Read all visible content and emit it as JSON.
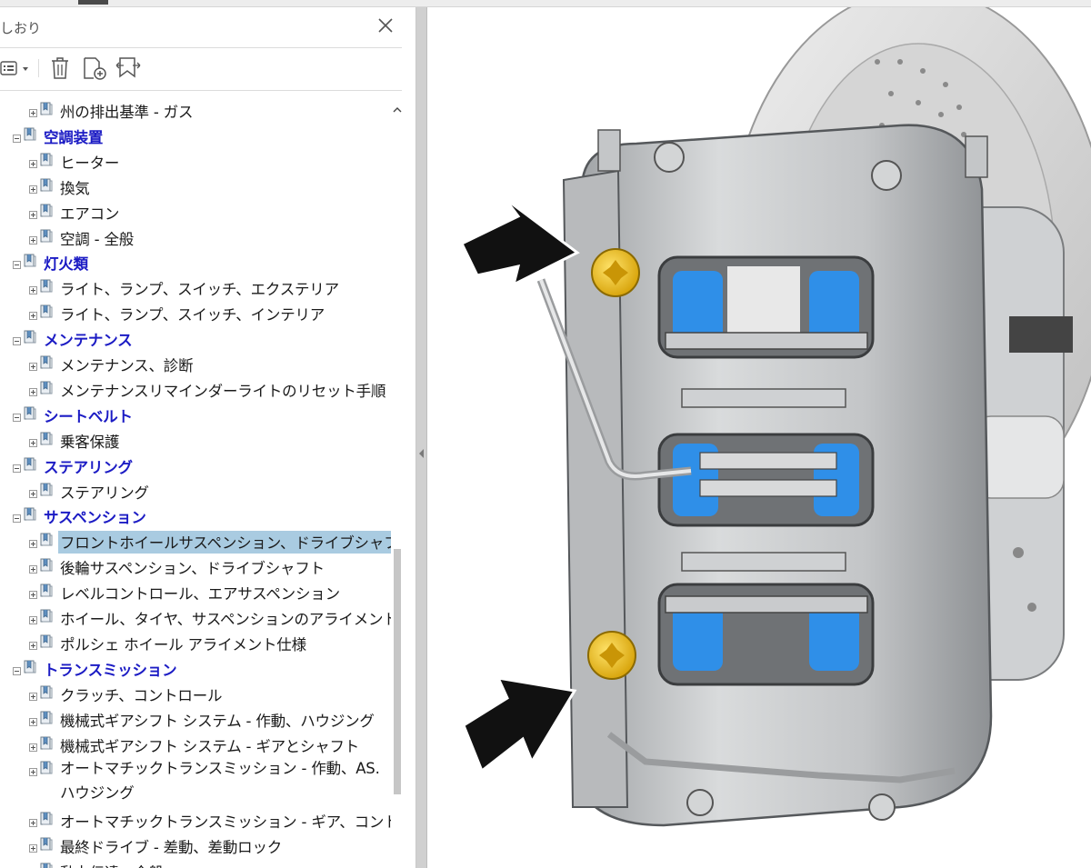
{
  "panel": {
    "title": "しおり",
    "toolbar": {
      "options_icon": "options-menu-icon",
      "delete_icon": "trash-icon",
      "new_bookmark_icon": "new-bookmark-icon",
      "expand_icon": "expand-bookmark-icon"
    }
  },
  "bookmarks": [
    {
      "level": 2,
      "label": "州の排出基準 - ガス",
      "expanded": false
    },
    {
      "level": 1,
      "label": "空調装置",
      "expanded": true
    },
    {
      "level": 2,
      "label": "ヒーター",
      "expanded": false
    },
    {
      "level": 2,
      "label": "換気",
      "expanded": false
    },
    {
      "level": 2,
      "label": "エアコン",
      "expanded": false
    },
    {
      "level": 2,
      "label": "空調 - 全般",
      "expanded": false
    },
    {
      "level": 1,
      "label": "灯火類",
      "expanded": true
    },
    {
      "level": 2,
      "label": "ライト、ランプ、スイッチ、エクステリア",
      "expanded": false
    },
    {
      "level": 2,
      "label": "ライト、ランプ、スイッチ、インテリア",
      "expanded": false
    },
    {
      "level": 1,
      "label": "メンテナンス",
      "expanded": true
    },
    {
      "level": 2,
      "label": "メンテナンス、診断",
      "expanded": false
    },
    {
      "level": 2,
      "label": "メンテナンスリマインダーライトのリセット手順",
      "expanded": false
    },
    {
      "level": 1,
      "label": "シートベルト",
      "expanded": true
    },
    {
      "level": 2,
      "label": "乗客保護",
      "expanded": false
    },
    {
      "level": 1,
      "label": "ステアリング",
      "expanded": true
    },
    {
      "level": 2,
      "label": "ステアリング",
      "expanded": false
    },
    {
      "level": 1,
      "label": "サスペンション",
      "expanded": true
    },
    {
      "level": 2,
      "label": "フロントホイールサスペンション、ドライブシャフト",
      "expanded": false,
      "selected": true
    },
    {
      "level": 2,
      "label": "後輪サスペンション、ドライブシャフト",
      "expanded": false
    },
    {
      "level": 2,
      "label": "レベルコントロール、エアサスペンション",
      "expanded": false
    },
    {
      "level": 2,
      "label": "ホイール、タイヤ、サスペンションのアライメント",
      "expanded": false
    },
    {
      "level": 2,
      "label": "ポルシェ ホイール アライメント仕様",
      "expanded": false
    },
    {
      "level": 1,
      "label": "トランスミッション",
      "expanded": true
    },
    {
      "level": 2,
      "label": "クラッチ、コントロール",
      "expanded": false
    },
    {
      "level": 2,
      "label": "機械式ギアシフト システム - 作動、ハウジング",
      "expanded": false
    },
    {
      "level": 2,
      "label": "機械式ギアシフト システム - ギアとシャフト",
      "expanded": false
    },
    {
      "level": 2,
      "label": "オートマチックトランスミッション - 作動、AS.ハウジング",
      "expanded": false,
      "wrap": true
    },
    {
      "level": 2,
      "label": "オートマチックトランスミッション - ギア、コントロール",
      "expanded": false
    },
    {
      "level": 2,
      "label": "最終ドライブ - 差動、差動ロック",
      "expanded": false
    },
    {
      "level": 2,
      "label": "動力伝達 - 全般",
      "expanded": false
    }
  ],
  "colors": {
    "level1_text": "#1b1bc4",
    "selection": "#a9cbe1",
    "caliper_body": "#c9cbcd",
    "brake_pad_blue": "#2f8fe8",
    "bolt_yellow": "#f2c21c"
  },
  "viewer": {
    "figure_icon": "brake-caliper-illustration"
  }
}
